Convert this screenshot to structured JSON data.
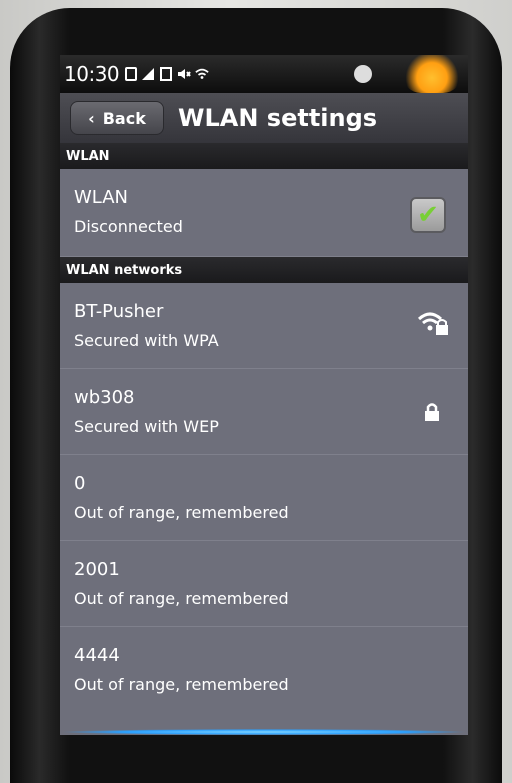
{
  "statusbar": {
    "time": "10:30",
    "icons": [
      "battery-icon",
      "signal-icon",
      "mute-icon",
      "wifi-icon"
    ]
  },
  "titlebar": {
    "back_label": "Back",
    "title": "WLAN settings"
  },
  "sections": {
    "wlan": "WLAN",
    "networks": "WLAN networks"
  },
  "wlan_toggle": {
    "title": "WLAN",
    "status": "Disconnected",
    "checked": true
  },
  "networks": [
    {
      "name": "BT-Pusher",
      "status": "Secured with WPA",
      "icon": "wifi-lock-icon"
    },
    {
      "name": "wb308",
      "status": "Secured with WEP",
      "icon": "lock-icon"
    },
    {
      "name": "0",
      "status": "Out of range, remembered",
      "icon": ""
    },
    {
      "name": "2001",
      "status": "Out of range, remembered",
      "icon": ""
    },
    {
      "name": "4444",
      "status": "Out of range, remembered",
      "icon": ""
    }
  ],
  "colors": {
    "screen_bg": "#6e6f7b",
    "check_green": "#78cf35",
    "header_bar": "#1a1a1c"
  }
}
